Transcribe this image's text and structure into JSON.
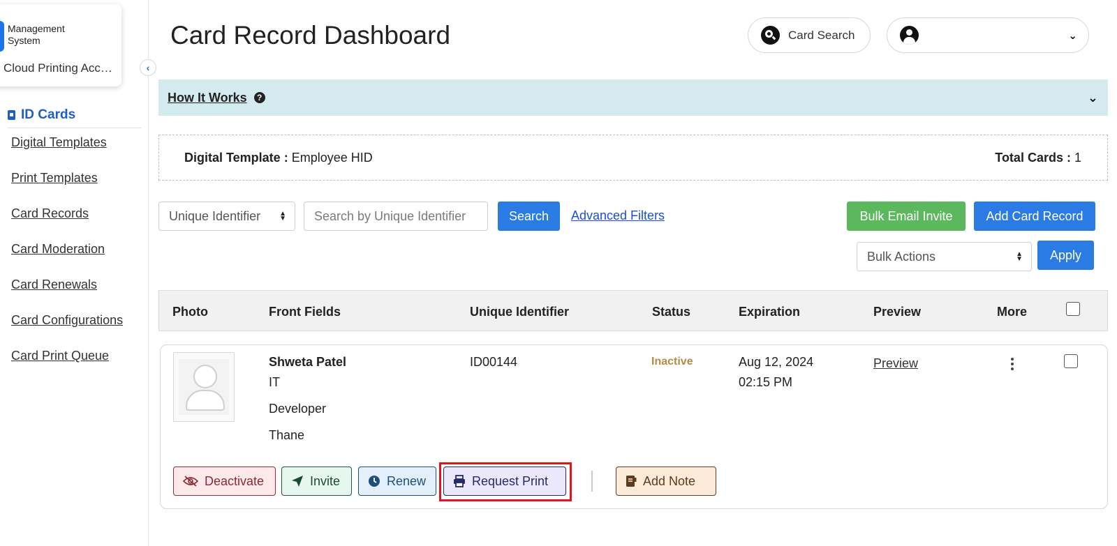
{
  "sidebar": {
    "brand_line1": "Management",
    "brand_line2": "System",
    "org_name": "Cloud Printing Account",
    "section_label": "ID Cards",
    "items": [
      {
        "label": "Digital Templates"
      },
      {
        "label": "Print Templates"
      },
      {
        "label": "Card Records"
      },
      {
        "label": "Card Moderation"
      },
      {
        "label": "Card Renewals"
      },
      {
        "label": "Card Configurations"
      },
      {
        "label": "Card Print Queue"
      }
    ]
  },
  "header": {
    "title": "Card Record Dashboard",
    "card_search_label": "Card Search"
  },
  "how_it_works": {
    "label": "How It Works",
    "help_glyph": "?",
    "chevron": "⌄"
  },
  "template_info": {
    "template_label": "Digital Template :",
    "template_value": "Employee HID",
    "total_label": "Total Cards :",
    "total_value": "1"
  },
  "filters": {
    "identifier_select": "Unique Identifier",
    "search_placeholder": "Search by Unique Identifier",
    "search_button": "Search",
    "advanced_filters": "Advanced Filters",
    "bulk_email_invite": "Bulk Email Invite",
    "add_card_record": "Add Card Record",
    "bulk_actions": "Bulk Actions",
    "apply": "Apply"
  },
  "table": {
    "columns": [
      "Photo",
      "Front Fields",
      "Unique Identifier",
      "Status",
      "Expiration",
      "Preview",
      "More"
    ],
    "rows": [
      {
        "name": "Shweta Patel",
        "department": "IT",
        "role": "Developer",
        "location": "Thane",
        "unique_identifier": "ID00144",
        "status": "Inactive",
        "expiration_date": "Aug 12, 2024",
        "expiration_time": "02:15 PM",
        "preview": "Preview",
        "actions": {
          "deactivate": "Deactivate",
          "invite": "Invite",
          "renew": "Renew",
          "request_print": "Request Print",
          "add_note": "Add Note"
        }
      }
    ]
  },
  "colors": {
    "primary": "#2b7be4",
    "success": "#5cb85c",
    "info_bar": "#d3ebef",
    "status_inactive": "#b58b46",
    "highlight": "#e0161f"
  }
}
